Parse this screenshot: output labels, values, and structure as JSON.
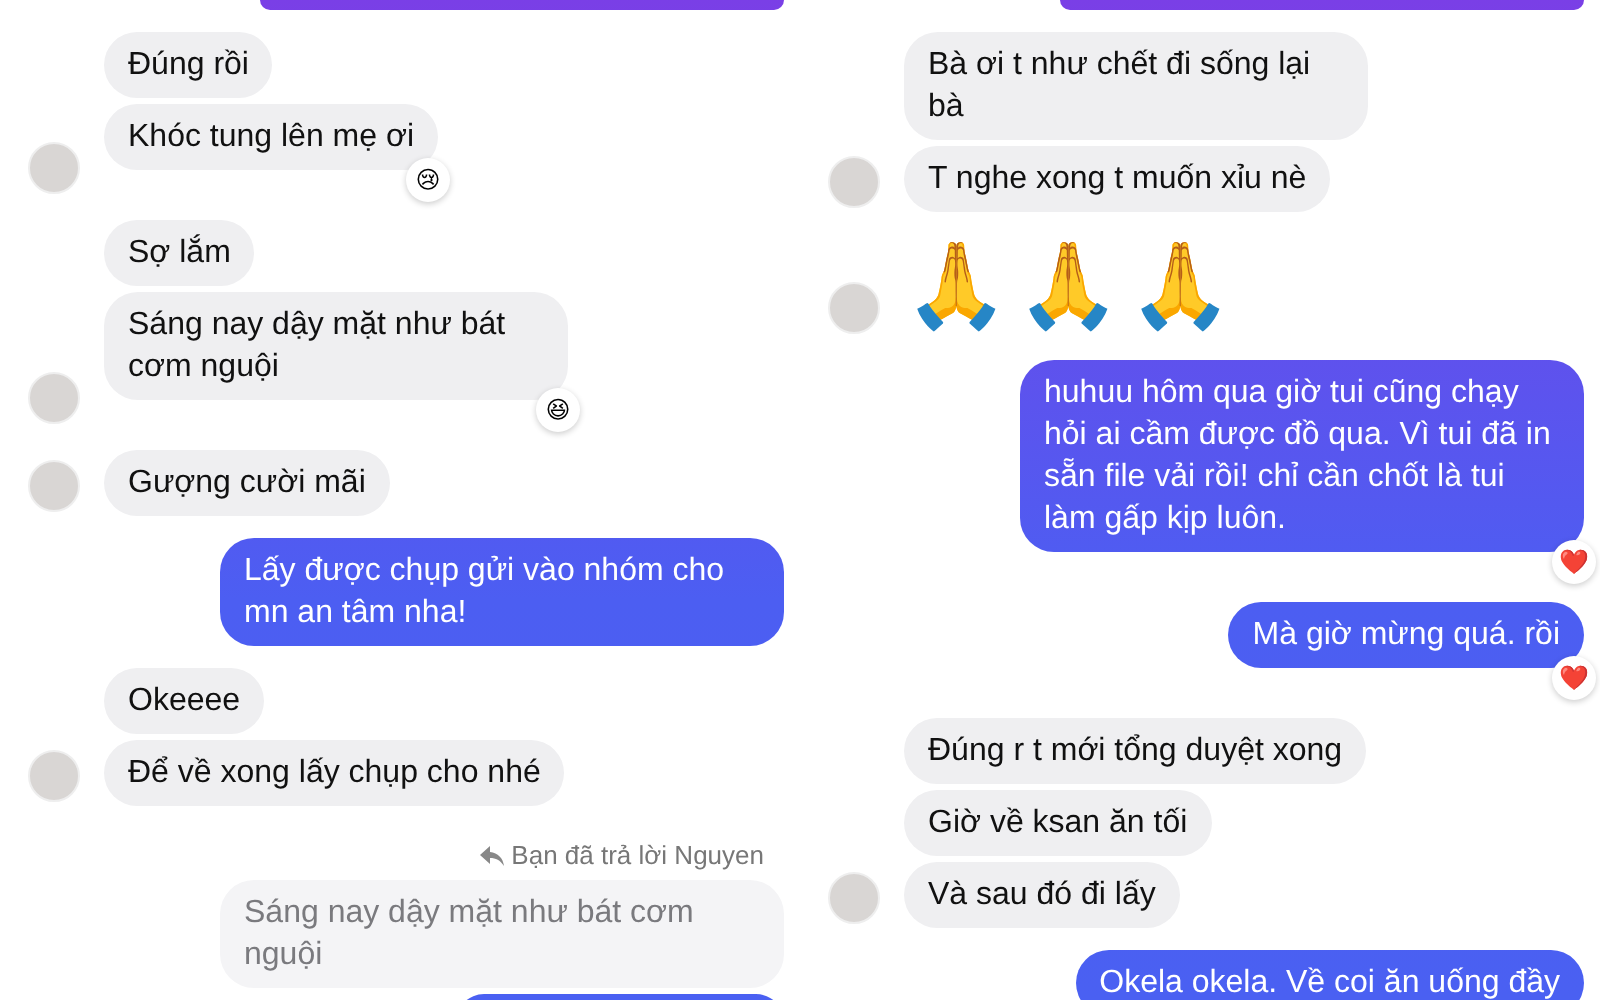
{
  "panels": [
    {
      "groups": [
        {
          "kind": "sent",
          "messages": [
            {
              "kind": "clipped"
            }
          ]
        },
        {
          "kind": "received",
          "messages": [
            {
              "kind": "text",
              "text": "Đúng rồi"
            },
            {
              "kind": "text",
              "text": "Khóc tung lên mẹ ơi",
              "reaction": "😢"
            }
          ]
        },
        {
          "kind": "received",
          "messages": [
            {
              "kind": "text",
              "text": "Sợ lắm"
            },
            {
              "kind": "text",
              "text": "Sáng nay dậy mặt như bát cơm nguội",
              "reaction": "😆"
            }
          ]
        },
        {
          "kind": "received",
          "messages": [
            {
              "kind": "text",
              "text": "Gượng cười mãi"
            }
          ]
        },
        {
          "kind": "sent",
          "messages": [
            {
              "kind": "text",
              "text": "Lấy được chụp gửi vào nhóm cho mn an tâm nha!"
            }
          ]
        },
        {
          "kind": "received",
          "messages": [
            {
              "kind": "text",
              "text": "Okeeee"
            },
            {
              "kind": "text",
              "text": "Để về xong lấy chụp cho nhé"
            }
          ]
        },
        {
          "kind": "sent",
          "reply_note": "Bạn đã trả lời Nguyen",
          "messages": [
            {
              "kind": "quote",
              "text": "Sáng nay dậy mặt như bát cơm nguội"
            },
            {
              "kind": "clipped"
            }
          ]
        }
      ]
    },
    {
      "groups": [
        {
          "kind": "sent",
          "messages": [
            {
              "kind": "clipped"
            }
          ]
        },
        {
          "kind": "received",
          "messages": [
            {
              "kind": "text",
              "text": "Bà ơi t như chết đi sống lại bà"
            },
            {
              "kind": "text",
              "text": "T nghe xong t muốn xỉu nè"
            }
          ]
        },
        {
          "kind": "received",
          "messages": [
            {
              "kind": "emoji",
              "text": "🙏🙏🙏"
            }
          ]
        },
        {
          "kind": "sent",
          "messages": [
            {
              "kind": "text",
              "text": "huhuu hôm qua giờ tui cũng chạy hỏi ai cầm được đồ qua. Vì tui đã in sẵn file vải rồi! chỉ cần chốt là tui làm gấp kịp luôn.",
              "reaction": "❤️"
            }
          ]
        },
        {
          "kind": "sent",
          "messages": [
            {
              "kind": "text",
              "text": "Mà giờ mừng quá. rồi",
              "reaction": "❤️"
            }
          ]
        },
        {
          "kind": "received",
          "messages": [
            {
              "kind": "text",
              "text": "Đúng r t mới tổng duyệt xong"
            },
            {
              "kind": "text",
              "text": "Giờ về ksan ăn tối"
            },
            {
              "kind": "text",
              "text": "Và sau đó đi lấy"
            }
          ]
        },
        {
          "kind": "sent",
          "messages": [
            {
              "kind": "text",
              "text": "Okela okela. Về coi ăn uống đầy"
            }
          ]
        }
      ]
    }
  ]
}
